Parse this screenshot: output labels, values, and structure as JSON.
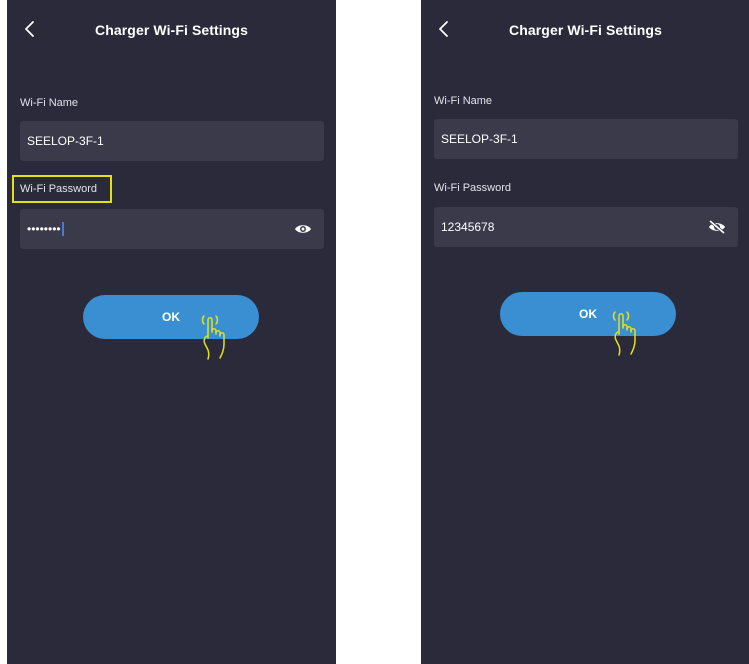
{
  "colors": {
    "screen_background": "#2b2a3a",
    "field_background": "#3b3a4b",
    "accent_button": "#3a8fd3",
    "highlight": "#e4e018",
    "caret": "#4a78d2"
  },
  "screens": [
    {
      "header": {
        "back_icon": "chevron-left-icon",
        "title": "Charger Wi-Fi Settings"
      },
      "wifi_name": {
        "label": "Wi-Fi Name",
        "value": "SEELOP-3F-1"
      },
      "wifi_password": {
        "label": "Wi-Fi Password",
        "value": "••••••••",
        "visibility_icon": "eye-icon",
        "label_highlighted": true
      },
      "ok_button": {
        "label": "OK"
      },
      "tap_indicator_icon": "hand-pointer-icon"
    },
    {
      "header": {
        "back_icon": "chevron-left-icon",
        "title": "Charger Wi-Fi Settings"
      },
      "wifi_name": {
        "label": "Wi-Fi Name",
        "value": "SEELOP-3F-1"
      },
      "wifi_password": {
        "label": "Wi-Fi Password",
        "value": "12345678",
        "visibility_icon": "eye-slash-icon",
        "label_highlighted": false
      },
      "ok_button": {
        "label": "OK"
      },
      "tap_indicator_icon": "hand-pointer-icon"
    }
  ]
}
